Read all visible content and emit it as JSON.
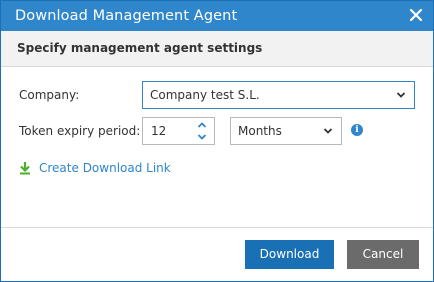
{
  "dialog": {
    "title": "Download Management Agent",
    "subtitle": "Specify management agent settings"
  },
  "form": {
    "company_label": "Company:",
    "company_value": "Company test S.L.",
    "token_label": "Token expiry period:",
    "token_value": "12",
    "period_value": "Months"
  },
  "link": {
    "create_download_link": "Create Download Link"
  },
  "buttons": {
    "download": "Download",
    "cancel": "Cancel"
  },
  "icons": {
    "close": "close-icon",
    "chevron": "chevron-down-icon",
    "spinner_up": "chevron-up-icon",
    "spinner_down": "chevron-down-icon",
    "info": "info-icon",
    "download": "download-icon"
  },
  "colors": {
    "accent": "#2f86cb",
    "primary_button": "#1a70b5",
    "secondary_button": "#6b6b6b",
    "header_band": "#f2f2f2"
  }
}
